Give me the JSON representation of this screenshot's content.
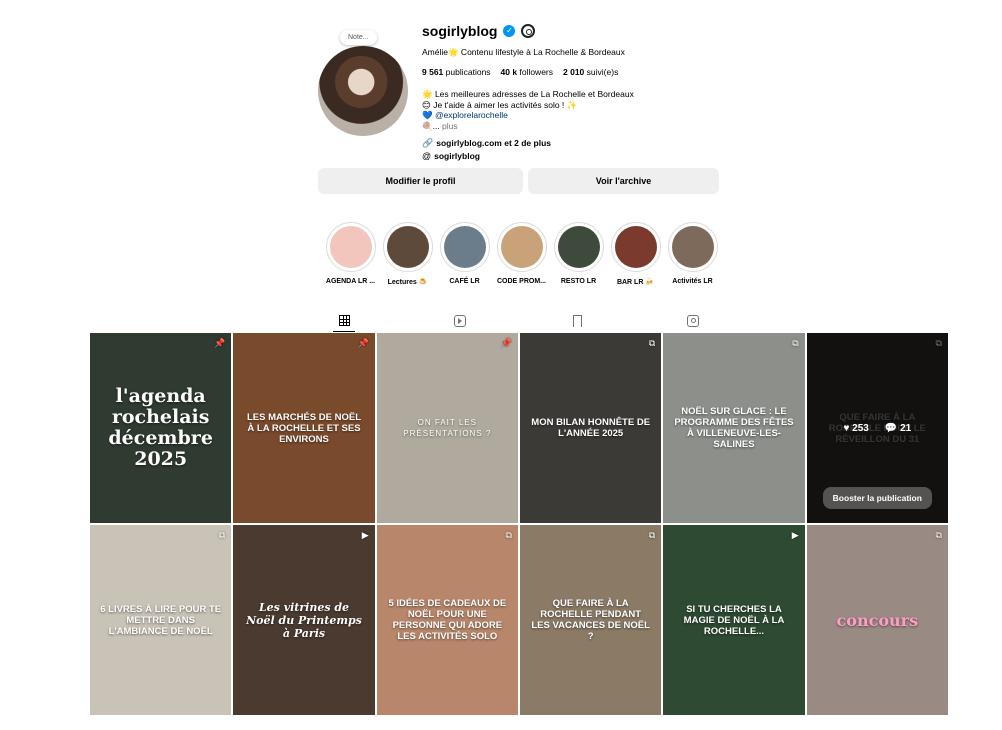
{
  "profile": {
    "note": "Note...",
    "username": "sogirlyblog",
    "tagline": "Amélie🌟 Contenu lifestyle à La Rochelle & Bordeaux",
    "stats": {
      "posts": "9 561",
      "posts_label": "publications",
      "followers": "40 k",
      "followers_label": "followers",
      "following": "2 010",
      "following_label": "suivi(e)s"
    },
    "bio_line1": "🌟 Les meilleures adresses de La Rochelle et Bordeaux",
    "bio_line2": "😊 Je t'aide à aimer les activités solo ! ✨",
    "bio_link": "💙 @explorelarochelle",
    "bio_more_prefix": "🍭... ",
    "bio_more": "plus",
    "website": "sogirlyblog.com et 2 de plus",
    "threads": "sogirlyblog"
  },
  "buttons": {
    "edit": "Modifier le profil",
    "archive": "Voir l'archive"
  },
  "highlights": [
    {
      "label": "AGENDA LR ...",
      "color": "#f2c6bd"
    },
    {
      "label": "Lectures 🍮",
      "color": "#5d4a3a"
    },
    {
      "label": "CAFÉ LR",
      "color": "#6b7c8a"
    },
    {
      "label": "CODE PROM...",
      "color": "#c9a27a"
    },
    {
      "label": "RESTO LR",
      "color": "#3e4a3b"
    },
    {
      "label": "BAR LR 🍻",
      "color": "#7a3b2e"
    },
    {
      "label": "Activités LR",
      "color": "#7d6a5a"
    }
  ],
  "posts": [
    {
      "title": "l'agenda rochelais décembre 2025",
      "bg": "#2f3a30",
      "style": "big",
      "corner": "📌"
    },
    {
      "title": "Les marchés de Noël à La Rochelle et ses environs",
      "bg": "#7a4a2c",
      "style": "",
      "corner": "📌"
    },
    {
      "title": "On fait les présentations ?",
      "bg": "#b0aa9e",
      "style": "caps-thin",
      "corner": "📌"
    },
    {
      "title": "Mon bilan honnête de l'année 2025",
      "bg": "#3c3a36",
      "style": "",
      "corner": "⧉"
    },
    {
      "title": "Noël sur glace : le programme des fêtes à Villeneuve-les-Salines",
      "bg": "#8c8f8a",
      "style": "",
      "corner": "⧉"
    },
    {
      "title": "Que faire à La Rochelle pour le réveillon du 31",
      "bg": "#2a2624",
      "style": "",
      "corner": "⧉",
      "overlay": {
        "likes": "253",
        "comments": "21",
        "boost": "Booster la publication"
      }
    },
    {
      "title": "6 livres à lire pour te mettre dans l'ambiance de Noël",
      "bg": "#c9c2b6",
      "style": "",
      "corner": "⧉"
    },
    {
      "title": "Les vitrines de Noël du Printemps à Paris",
      "bg": "#4a3a30",
      "style": "script",
      "corner": "▶"
    },
    {
      "title": "5 idées de cadeaux de Noël pour une personne qui adore les activités solo",
      "bg": "#b8866a",
      "style": "",
      "corner": "⧉"
    },
    {
      "title": "Que faire à La Rochelle pendant les vacances de Noël ?",
      "bg": "#8a7a66",
      "style": "",
      "corner": "⧉"
    },
    {
      "title": "Si tu cherches la magie de Noël à La Rochelle...",
      "bg": "#2e4a32",
      "style": "",
      "corner": "▶"
    },
    {
      "title": "concours",
      "bg": "#9a8a84",
      "style": "pink",
      "corner": "⧉"
    }
  ],
  "tabs": [
    "grid-icon",
    "reels-icon",
    "saved-icon",
    "tagged-icon"
  ]
}
